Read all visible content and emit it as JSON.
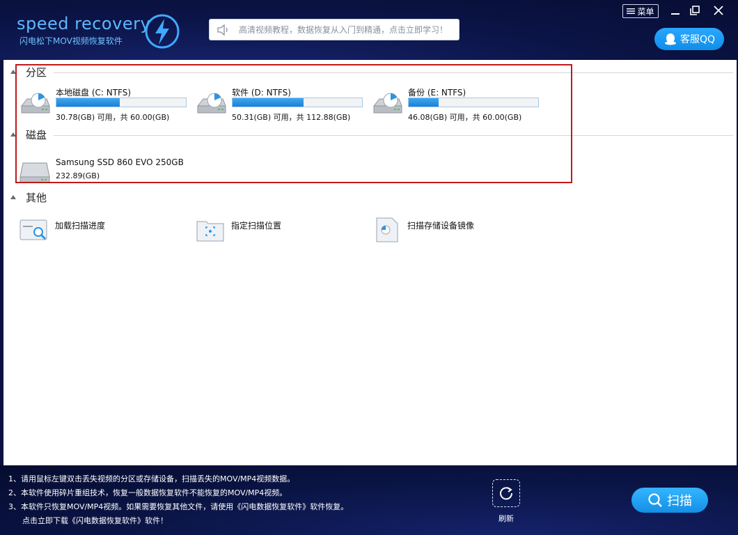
{
  "app": {
    "logo_text": "speed recovery",
    "logo_subtitle": "闪电松下MOV视频恢复软件"
  },
  "header": {
    "notice_text": "高清视频教程，数据恢复从入门到精通，点击立即学习！",
    "menu_label": "菜单",
    "qq_label": "客服QQ"
  },
  "sections": {
    "partitions_title": "分区",
    "disks_title": "磁盘",
    "other_title": "其他"
  },
  "partitions": [
    {
      "name": "本地磁盘 (C: NTFS)",
      "size_text": "30.78(GB) 可用，共 60.00(GB)",
      "used_fraction": 0.49
    },
    {
      "name": "软件 (D: NTFS)",
      "size_text": "50.31(GB) 可用，共 112.88(GB)",
      "used_fraction": 0.55
    },
    {
      "name": "备份 (E: NTFS)",
      "size_text": "46.08(GB) 可用，共 60.00(GB)",
      "used_fraction": 0.23
    }
  ],
  "disks": [
    {
      "name": "Samsung SSD 860 EVO 250GB",
      "size_text": "232.89(GB)"
    }
  ],
  "other": [
    {
      "label": "加载扫描进度",
      "icon": "load-scan-progress-icon"
    },
    {
      "label": "指定扫描位置",
      "icon": "scan-location-icon"
    },
    {
      "label": "扫描存储设备镜像",
      "icon": "disk-image-icon"
    }
  ],
  "footer": {
    "tips": [
      "1、请用鼠标左键双击丢失视频的分区或存储设备，扫描丢失的MOV/MP4视频数据。",
      "2、本软件使用碎片重组技术，恢复一般数据恢复软件不能恢复的MOV/MP4视频。",
      "3、本软件只恢复MOV/MP4视频。如果需要恢复其他文件，请使用《闪电数据恢复软件》软件恢复。",
      "     点击立即下载《闪电数据恢复软件》软件！"
    ],
    "refresh_label": "刷新",
    "scan_label": "扫描"
  },
  "colors": {
    "header_bg": "#0b1446",
    "accent": "#1c8fe6",
    "bar_fill": "#2b94e3",
    "highlight_frame": "#c01818"
  }
}
